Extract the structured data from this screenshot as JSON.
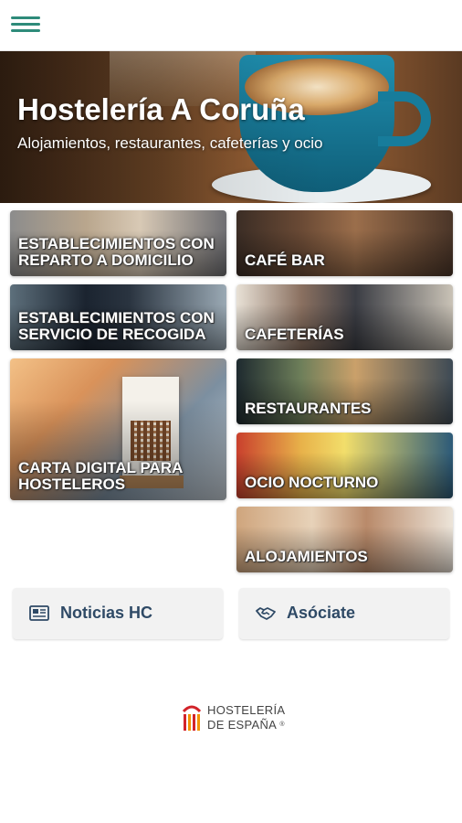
{
  "header": {
    "menu_icon": "hamburger-icon",
    "accent": "#2e8b7a"
  },
  "hero": {
    "title": "Hostelería A Coruña",
    "subtitle": "Alojamientos, restaurantes, cafeterías y ocio"
  },
  "tiles": {
    "reparto": "ESTABLECIMIENTOS CON REPARTO A DOMICILIO",
    "cafe_bar": "CAFÉ BAR",
    "recogida": "ESTABLECIMIENTOS CON SERVICIO DE RECOGIDA",
    "cafeterias": "CAFETERÍAS",
    "carta": "CARTA DIGITAL PARA HOSTELEROS",
    "restaurantes": "RESTAURANTES",
    "ocio": "OCIO NOCTURNO",
    "alojamientos": "ALOJAMIENTOS"
  },
  "buttons": {
    "noticias": {
      "label": "Noticias HC",
      "icon": "newspaper-icon"
    },
    "asociate": {
      "label": "Asóciate",
      "icon": "handshake-icon"
    }
  },
  "footer": {
    "logo_line1": "HOSTELERÍA",
    "logo_line2": "DE ESPAÑA",
    "logo_mark": "®",
    "brand_colors": {
      "red": "#d2232a",
      "orange": "#f39200"
    }
  }
}
